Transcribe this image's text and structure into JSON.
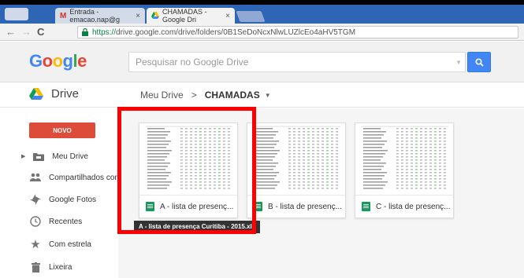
{
  "browser": {
    "tabs": [
      {
        "label": "Entrada - emacao.nap@g",
        "close": "×"
      },
      {
        "label": "CHAMADAS - Google Dri",
        "close": "×"
      }
    ],
    "url_https": "https://",
    "url_rest": "drive.google.com/drive/folders/0B1SeDoNcxNlwLUZlcEo4aHV5TGM"
  },
  "header": {
    "logo": "Google",
    "search_placeholder": "Pesquisar no Google Drive"
  },
  "subbar": {
    "app": "Drive",
    "crumb_root": "Meu Drive",
    "crumb_sep": ">",
    "crumb_current": "CHAMADAS"
  },
  "sidebar": {
    "new_button": "NOVO",
    "items": [
      {
        "label": "Meu Drive",
        "icon": "folder-icon"
      },
      {
        "label": "Compartilhados comigo",
        "icon": "shared-people-icon"
      },
      {
        "label": "Google Fotos",
        "icon": "photos-icon"
      },
      {
        "label": "Recentes",
        "icon": "clock-icon"
      },
      {
        "label": "Com estrela",
        "icon": "star-icon"
      },
      {
        "label": "Lixeira",
        "icon": "trash-icon"
      }
    ]
  },
  "files": [
    {
      "name": "A - lista de presenç..."
    },
    {
      "name": "B - lista de presenç..."
    },
    {
      "name": "C - lista de presenç..."
    }
  ],
  "tooltip": "A - lista de presença Curitiba - 2015.xls",
  "colors": {
    "highlight": "#ff0000",
    "new_button": "#dd4b39",
    "search_button": "#4285f4",
    "sheets": "#0f9d58"
  }
}
